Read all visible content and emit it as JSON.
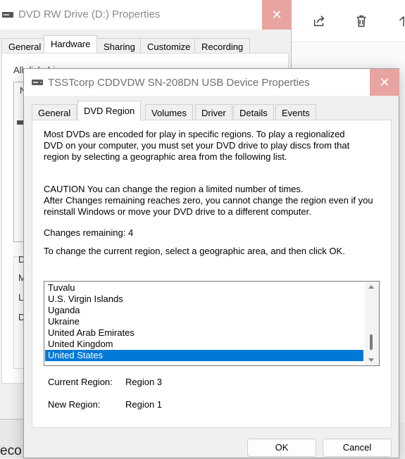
{
  "back_window": {
    "title": "DVD RW Drive (D:) Properties",
    "close_glyph": "✕",
    "tabs": [
      "General",
      "Hardware",
      "Sharing",
      "Customize",
      "Recording"
    ],
    "active_tab": "Hardware",
    "labels": {
      "all_disk_drives": "All disk drives:",
      "n": "N",
      "d": "D",
      "m": "M",
      "l": "L",
      "d2": "D"
    }
  },
  "background": {
    "partial_text": "eco"
  },
  "dialog": {
    "title": "TSSTcorp CDDVDW SN-208DN USB Device Properties",
    "close_glyph": "✕",
    "tabs": {
      "general": "General",
      "dvd_region": "DVD Region",
      "volumes": "Volumes",
      "driver": "Driver",
      "details": "Details",
      "events": "Events"
    },
    "active_tab": "DVD Region",
    "intro_lines": [
      "Most DVDs are encoded for play in specific regions. To play a regionalized",
      "DVD on your computer, you must set your DVD drive to play discs from that",
      "region by selecting a geographic area from the following list."
    ],
    "caution_lines": [
      "CAUTION   You can change the region a limited number of times.",
      "After Changes remaining reaches zero, you cannot change the region even if you",
      "reinstall Windows or move your DVD drive to a different computer."
    ],
    "changes_remaining": "Changes remaining: 4",
    "instruction": "To change the current region, select a geographic area, and then click OK.",
    "regions": [
      "Tuvalu",
      "U.S. Virgin Islands",
      "Uganda",
      "Ukraine",
      "United Arab Emirates",
      "United Kingdom",
      "United States"
    ],
    "selected_region": "United States",
    "current_region_label": "Current Region:",
    "current_region_value": "Region 3",
    "new_region_label": "New Region:",
    "new_region_value": "Region 1",
    "ok_label": "OK",
    "cancel_label": "Cancel"
  },
  "colors": {
    "selection": "#0078d7",
    "close_button": "#e8a4a1"
  },
  "icons": [
    "drive-icon",
    "dvd-drive-icon",
    "share-icon",
    "trash-icon",
    "arrow-up-icon"
  ]
}
